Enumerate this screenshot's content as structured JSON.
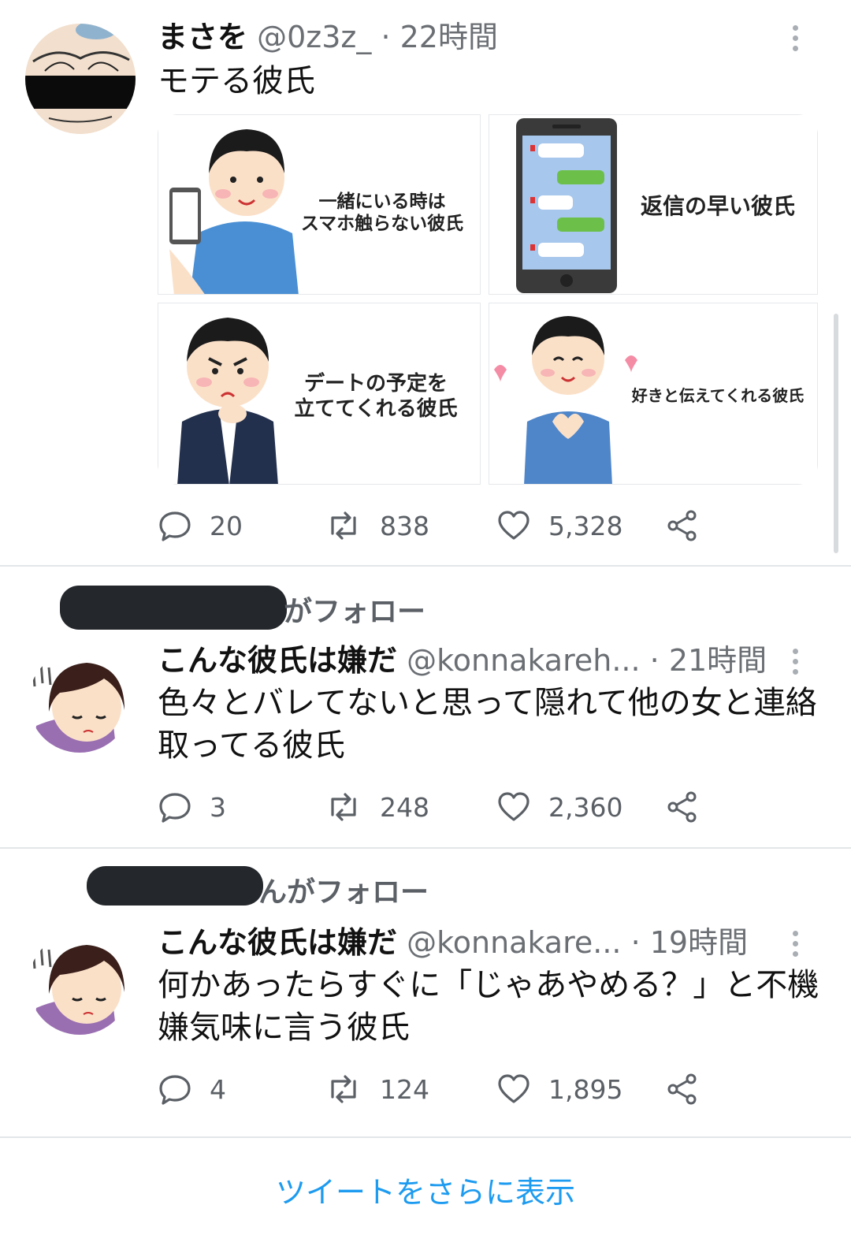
{
  "tweets": [
    {
      "name": "まさを",
      "handle": "@0z3z_",
      "time": "· 22時間",
      "text": "モテる彼氏",
      "images": [
        {
          "caption_lines": [
            "一緒にいる時は",
            "スマホ触らない彼氏"
          ]
        },
        {
          "caption_lines": [
            "返信の早い彼氏"
          ]
        },
        {
          "caption_lines": [
            "デートの予定を",
            "立ててくれる彼氏"
          ]
        },
        {
          "caption_lines": [
            "好きと伝えてくれる彼氏"
          ]
        }
      ],
      "replies": "20",
      "retweets": "838",
      "likes": "5,328"
    },
    {
      "followed_by": "がフォロー",
      "name": "こんな彼氏は嫌だ",
      "handle": "@konnakareh...",
      "time": "· 21時間",
      "text": "色々とバレてないと思って隠れて他の女と連絡取ってる彼氏",
      "replies": "3",
      "retweets": "248",
      "likes": "2,360"
    },
    {
      "followed_by": "んがフォロー",
      "name": "こんな彼氏は嫌だ",
      "handle": "@konnakare...",
      "time": "· 19時間",
      "text": "何かあったらすぐに「じゃあやめる？」と不機嫌気味に言う彼氏",
      "replies": "4",
      "retweets": "124",
      "likes": "1,895"
    }
  ],
  "show_more": "ツイートをさらに表示",
  "colors": {
    "accent": "#1d9bf0",
    "muted": "#5b6066",
    "divider": "#e3e6e8"
  },
  "icons": [
    "reply-icon",
    "retweet-icon",
    "like-icon",
    "share-icon",
    "more-icon"
  ]
}
